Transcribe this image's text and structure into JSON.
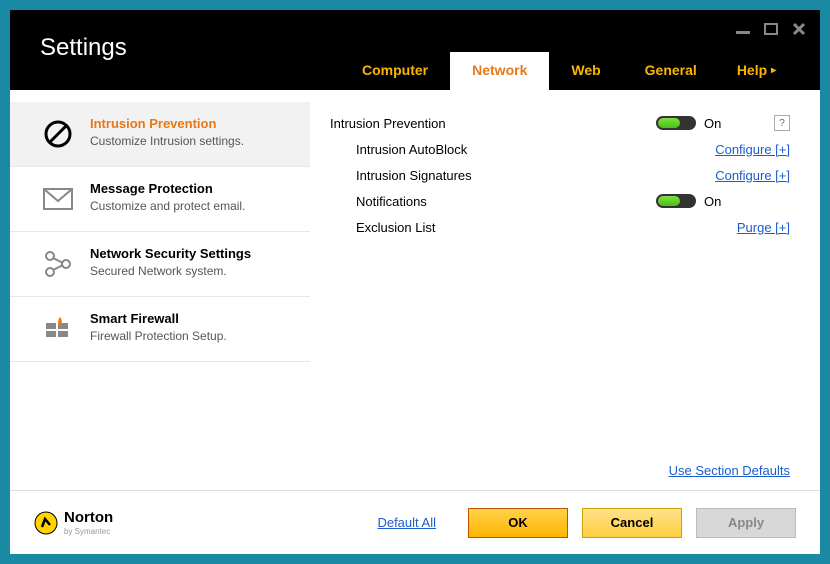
{
  "title": "Settings",
  "tabs": {
    "computer": "Computer",
    "network": "Network",
    "web": "Web",
    "general": "General",
    "help": "Help"
  },
  "sidebar": {
    "items": [
      {
        "title": "Intrusion Prevention",
        "sub": "Customize Intrusion settings."
      },
      {
        "title": "Message Protection",
        "sub": "Customize and protect email."
      },
      {
        "title": "Network Security Settings",
        "sub": "Secured Network system."
      },
      {
        "title": "Smart Firewall",
        "sub": "Firewall Protection Setup."
      }
    ]
  },
  "content": {
    "heading": "Intrusion Prevention",
    "heading_toggle": "On",
    "help": "?",
    "rows": [
      {
        "label": "Intrusion AutoBlock",
        "action": "Configure [+]"
      },
      {
        "label": "Intrusion Signatures",
        "action": "Configure [+]"
      },
      {
        "label": "Notifications",
        "toggle": "On"
      },
      {
        "label": "Exclusion List",
        "action": "Purge [+]"
      }
    ],
    "section_defaults": "Use Section Defaults"
  },
  "footer": {
    "brand": "Norton",
    "brand_sub": "by Symantec",
    "default_all": "Default All",
    "ok": "OK",
    "cancel": "Cancel",
    "apply": "Apply"
  }
}
